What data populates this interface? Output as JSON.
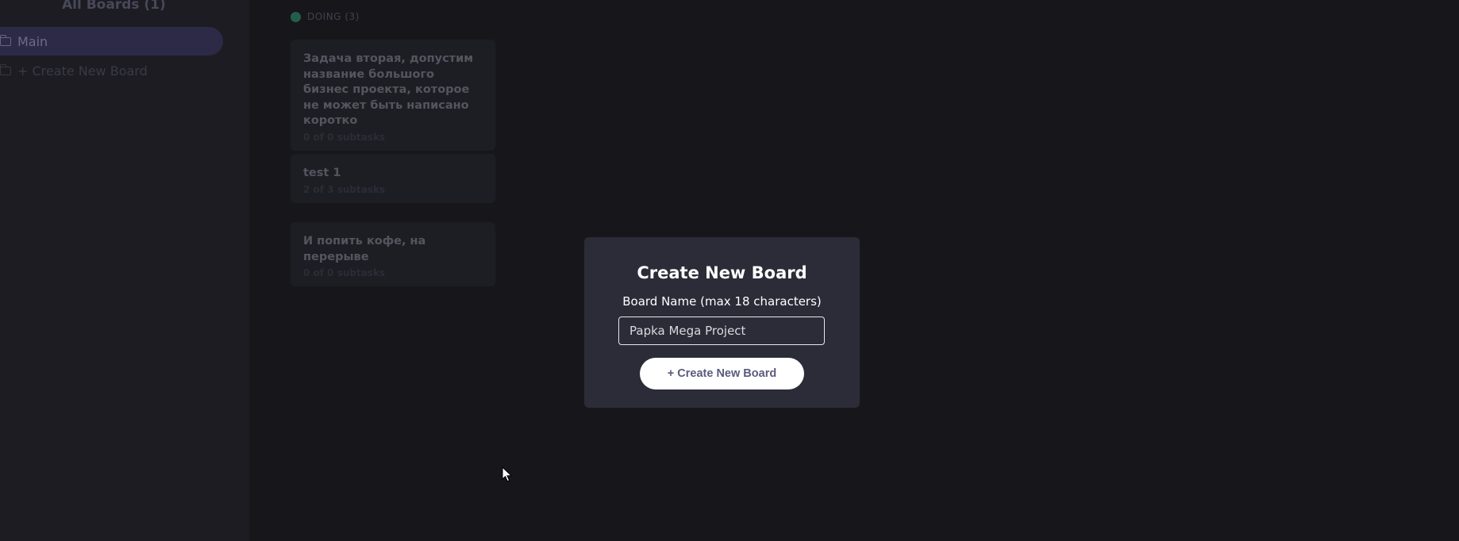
{
  "sidebar": {
    "heading": "All Boards (1)",
    "items": [
      {
        "label": "Main",
        "icon": "folder-icon",
        "active": true
      },
      {
        "label": "+ Create New Board",
        "icon": "folder-icon",
        "active": false
      }
    ]
  },
  "board": {
    "column": {
      "status_color": "#245e4a",
      "label": "DOING (3)",
      "tasks": [
        {
          "title": "Задача вторая, допустим название большого бизнес проекта, которое не может быть написано коротко",
          "subtasks": "0 of 0 subtasks"
        },
        {
          "title": "test 1",
          "subtasks": "2 of 3 subtasks"
        },
        {
          "title": "И попить кофе, на перерыве",
          "subtasks": "0 of 0 subtasks"
        }
      ]
    }
  },
  "modal": {
    "title": "Create New Board",
    "field_label": "Board Name (max 18 characters)",
    "input_value": "Papka Mega Project",
    "button_label": "+ Create New Board"
  },
  "colors": {
    "background": "#17171b",
    "sidebar": "#1c1c22",
    "modal": "#2b2c37",
    "active_nav": "#2c2a47",
    "button_text": "#5a5a7e"
  }
}
